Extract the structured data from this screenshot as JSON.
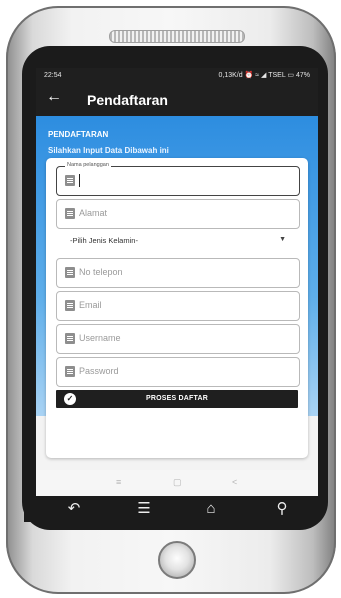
{
  "status_bar": {
    "time": "22:54",
    "indicators": "0,13K/d ⏰ ≈ ◢ TSEL ▭ 47%"
  },
  "app_bar": {
    "back_label": "←",
    "title": "Pendaftaran"
  },
  "header": {
    "title": "PENDAFTARAN",
    "subtitle": "Silahkan Input Data Dibawah ini"
  },
  "form": {
    "nama": {
      "label": "Nama pelanggan",
      "value": ""
    },
    "alamat": {
      "placeholder": "Alamat"
    },
    "jenis_kelamin": {
      "selected": "-Pilih Jenis Kelamin-"
    },
    "telepon": {
      "placeholder": "No telepon"
    },
    "email": {
      "placeholder": "Email"
    },
    "username": {
      "placeholder": "Username"
    },
    "password": {
      "placeholder": "Password"
    },
    "submit_label": "PROSES DAFTAR"
  },
  "nav_bar": {
    "menu": "≡",
    "home": "▢",
    "back": "<"
  },
  "hardware_keys": {
    "back": "↶",
    "menu": "☰",
    "home": "⌂",
    "search": "⚲"
  },
  "colors": {
    "appbar": "#1f1f1f",
    "hero_top": "#2d8de0",
    "button": "#1f1f1f"
  }
}
